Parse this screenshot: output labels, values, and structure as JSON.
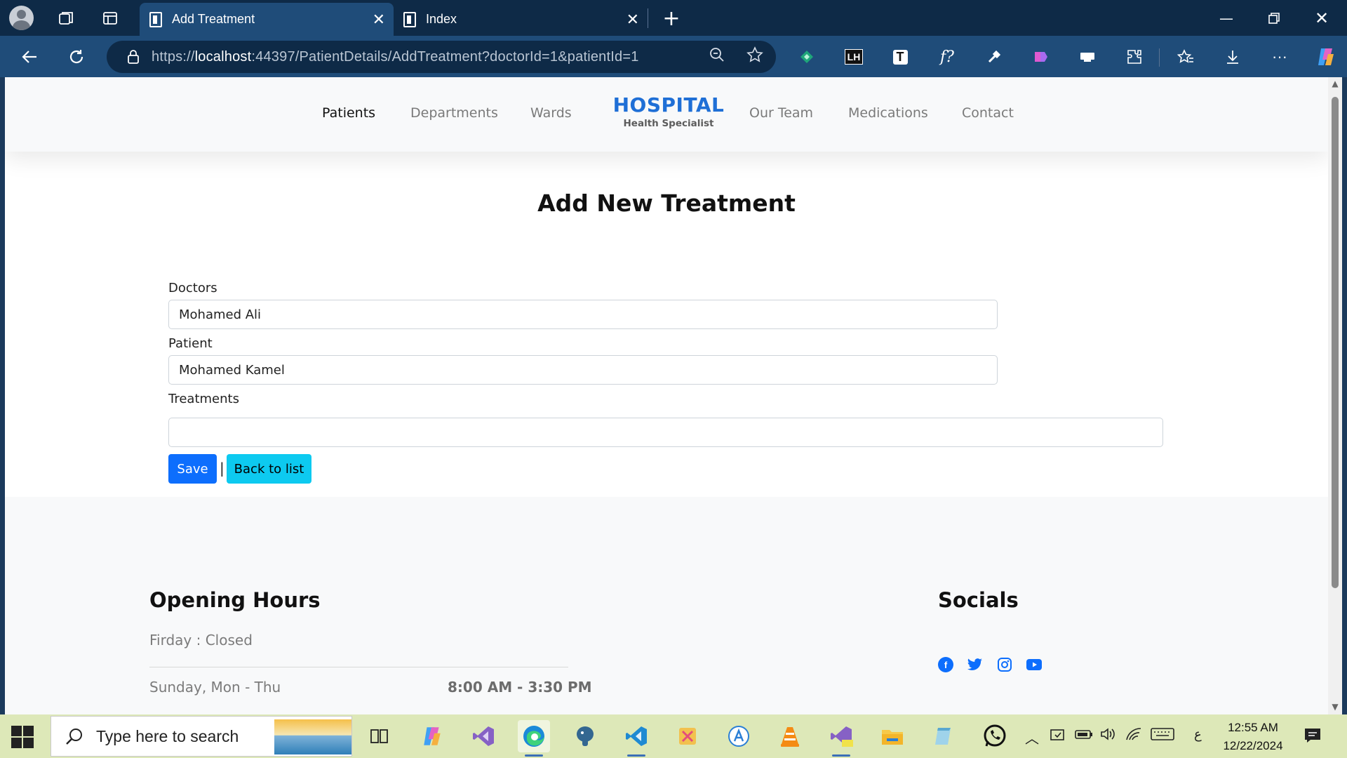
{
  "browser": {
    "tabs": [
      {
        "label": "Add Treatment",
        "active": true
      },
      {
        "label": "Index",
        "active": false
      }
    ],
    "url_scheme": "https://",
    "url_host": "localhost",
    "url_rest": ":44397/PatientDetails/AddTreatment?doctorId=1&patientId=1",
    "extensions": [
      "LH",
      "T",
      "f?"
    ]
  },
  "site": {
    "nav_left": [
      "Patients",
      "Departments",
      "Wards"
    ],
    "brand_title": "HOSPITAL",
    "brand_subtitle": "Health Specialist",
    "nav_right": [
      "Our Team",
      "Medications",
      "Contact"
    ],
    "active_nav": "Patients",
    "accent_color": "#1f6fd6"
  },
  "form": {
    "title": "Add New Treatment",
    "doctors_label": "Doctors",
    "doctors_value": "Mohamed Ali",
    "patient_label": "Patient",
    "patient_value": "Mohamed Kamel",
    "treatments_label": "Treatments",
    "treatments_value": "",
    "save_label": "Save",
    "separator": "|",
    "back_label": "Back to list"
  },
  "footer": {
    "hours_heading": "Opening Hours",
    "friday": "Firday : Closed",
    "weekdays_label": "Sunday, Mon - Thu",
    "weekdays_hours": "8:00 AM - 3:30 PM",
    "socials_heading": "Socials",
    "socials": [
      "facebook-icon",
      "twitter-icon",
      "instagram-icon",
      "youtube-icon"
    ]
  },
  "taskbar": {
    "search_placeholder": "Type here to search",
    "time": "12:55 AM",
    "date": "12/22/2024",
    "language": "ع"
  }
}
